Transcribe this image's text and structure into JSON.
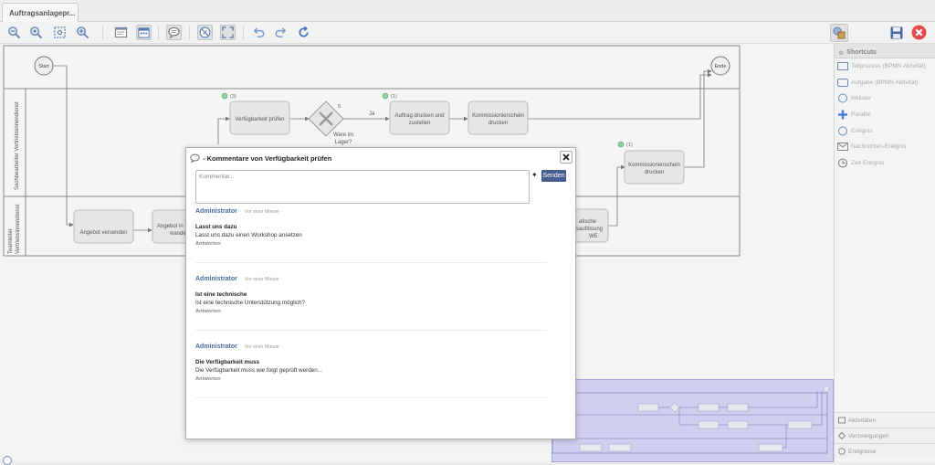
{
  "tab": {
    "title": "Auftragsanlagepr..."
  },
  "toolbar": {
    "buttons": [
      "zoom-out-icon",
      "zoom-reset-icon",
      "zoom-fit-icon",
      "zoom-in-icon",
      "properties-icon",
      "calendar-icon",
      "comments-icon",
      "attach-icon",
      "fullscreen-icon",
      "undo-icon",
      "redo-icon",
      "refresh-icon"
    ],
    "right_buttons": [
      "shapes-icon",
      "save-icon",
      "close-icon"
    ]
  },
  "diagram": {
    "lanes": [
      "Sachbearbeiter Vertriebsinnendienst",
      "Teamleiter Vertriebsinnendienst"
    ],
    "events": {
      "start": "Start",
      "end": "Ende"
    },
    "tasks": {
      "verfuegbarkeit": "Verfügbarkeit prüfen",
      "auftrag_1": "Auftrag drucken und",
      "auftrag_2": "zustellen",
      "kommission_1": "Kommissionierschein",
      "kommission_2": "drucken",
      "kommission_b_1": "Kommissionierschein",
      "kommission_b_2": "drucken",
      "angebot_versenden": "Angebot versenden",
      "angebot_2_1": "Angebot in",
      "angebot_2_2": "wandeln",
      "statische_1": "atische",
      "statische_2": "sauflösung",
      "statische_3": "WE"
    },
    "gateway": {
      "count": "5",
      "label_1": "Ware im",
      "label_2": "Lager?",
      "yes": "Ja"
    },
    "comment_counts": {
      "verfuegbarkeit": "(3)",
      "auftrag": "(1)",
      "kommission_b": "(1)"
    }
  },
  "shortcuts": {
    "title": "Shortcuts",
    "items": [
      {
        "icon": "subprocess-icon",
        "label": "Teilprozess (BPMN Aktivität)"
      },
      {
        "icon": "task-icon",
        "label": "Aufgabe (BPMN Aktivität)"
      },
      {
        "icon": "inclusive-icon",
        "label": "Inklusiv"
      },
      {
        "icon": "parallel-icon",
        "label": "Parallel"
      },
      {
        "icon": "event-icon",
        "label": "Ereignis"
      },
      {
        "icon": "message-event-icon",
        "label": "Nachrichten-Ereignis"
      },
      {
        "icon": "timer-event-icon",
        "label": "Zeit-Ereignis"
      }
    ],
    "footer": [
      "Aktivitäten",
      "Verzweigungen",
      "Ereignisse"
    ]
  },
  "dialog": {
    "title": "- Kommentare von Verfügbarkeit prüfen",
    "input_placeholder": "Kommentar...",
    "plus": "✦",
    "send_label": "Senden",
    "comments": [
      {
        "author": "Administrator",
        "time": "Vor einer Minute  ·",
        "subject": "Lasst uns dazu",
        "body": "Lasst uns dazu einen Workshop ansetzen",
        "reply": "Antworten"
      },
      {
        "author": "Administrator",
        "time": "Vor einer Minute  ·",
        "subject": "Ist eine technische",
        "body": "Ist eine technische Unterstützung möglich?",
        "reply": "Antworten"
      },
      {
        "author": "Administrator",
        "time": "Vor einer Minute  ·",
        "subject": "Die Verfügbarkeit muss",
        "body": "Die Verfügbarkeit muss wie folgt geprüft werden...",
        "reply": "Antworten"
      }
    ]
  },
  "colors": {
    "accent": "#435e8f",
    "author": "#4a6aa0",
    "minimap": "#cfd0ef",
    "close_red": "#e24b4b"
  }
}
